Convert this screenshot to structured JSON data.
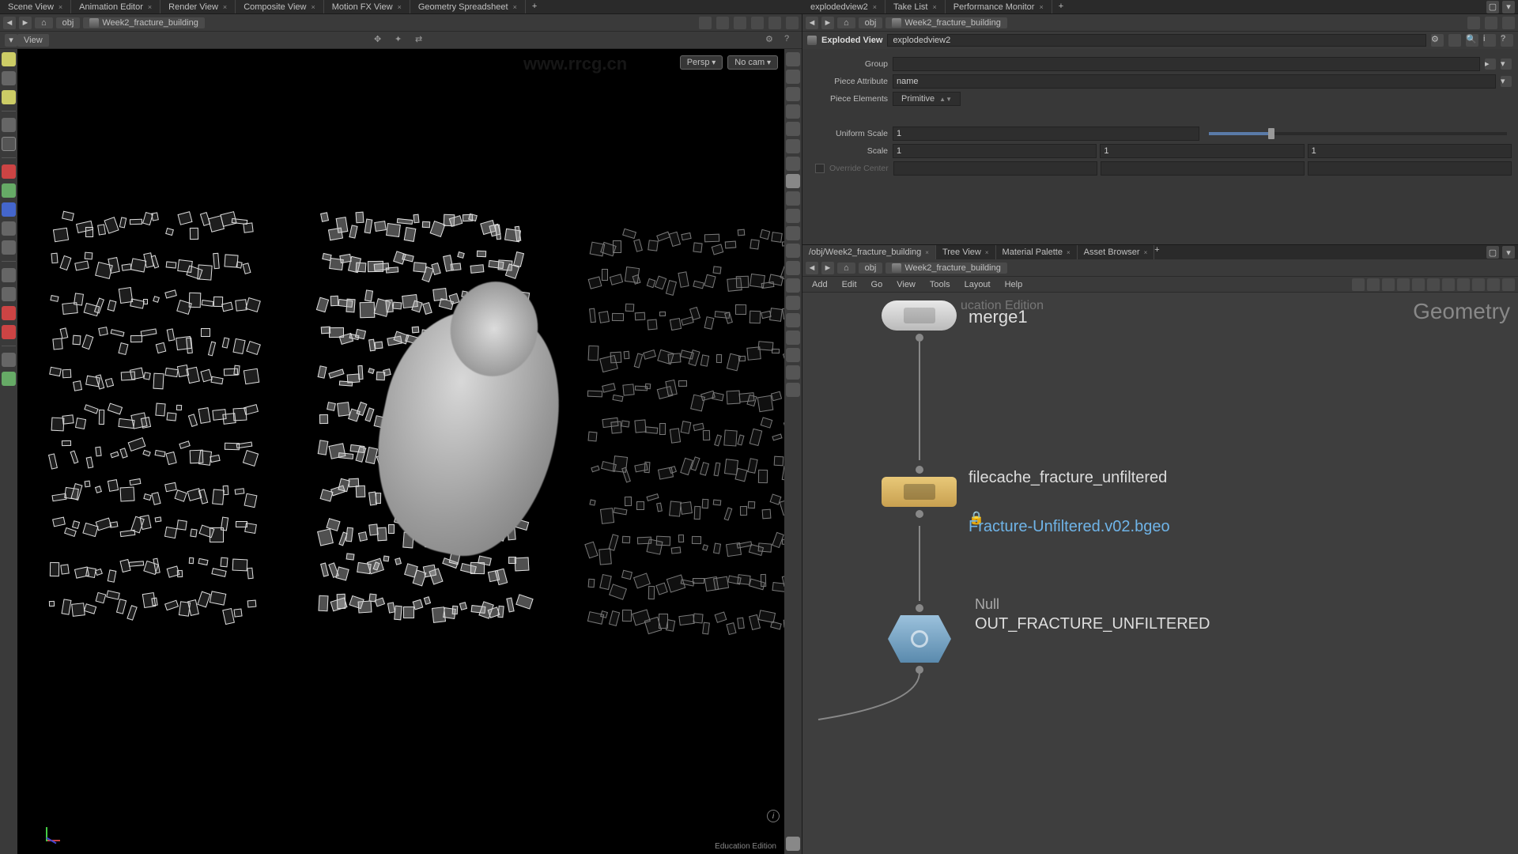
{
  "toptabs_left": [
    "Scene View",
    "Animation Editor",
    "Render View",
    "Composite View",
    "Motion FX View",
    "Geometry Spreadsheet"
  ],
  "toptabs_right": [
    "explodedview2",
    "Take List",
    "Performance Monitor"
  ],
  "path_obj": "obj",
  "path_node": "Week2_fracture_building",
  "view_dropdown": "View",
  "vp_persp": "Persp",
  "vp_cam": "No cam",
  "vp_footer": "Education Edition",
  "param": {
    "header_label": "Exploded View",
    "header_name": "explodedview2",
    "group_label": "Group",
    "group_value": "",
    "pieceattr_label": "Piece Attribute",
    "pieceattr_value": "name",
    "pieceel_label": "Piece Elements",
    "pieceel_value": "Primitive",
    "uscale_label": "Uniform Scale",
    "uscale_value": "1",
    "scale_label": "Scale",
    "scale_x": "1",
    "scale_y": "1",
    "scale_z": "1",
    "override_label": "Override Center"
  },
  "net_tabs": [
    "/obj/Week2_fracture_building",
    "Tree View",
    "Material Palette",
    "Asset Browser"
  ],
  "net_menu": [
    "Add",
    "Edit",
    "Go",
    "View",
    "Tools",
    "Layout",
    "Help"
  ],
  "net_corner": "Geometry",
  "net_edu": "ucation Edition",
  "nodes": {
    "merge": "merge1",
    "filecache": "filecache_fracture_unfiltered",
    "filecache_sub": "Fracture-Unfiltered.v02.bgeo",
    "null_top": "Null",
    "null": "OUT_FRACTURE_UNFILTERED"
  },
  "watermark_url": "www.rrcg.cn"
}
